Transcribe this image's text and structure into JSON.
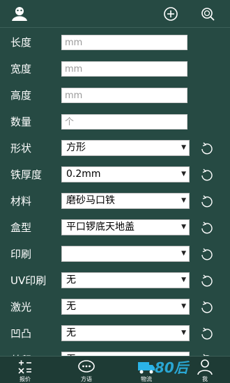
{
  "header": {
    "add_icon": "plus-circle-icon",
    "search_icon": "search-icon",
    "logo_icon": "app-logo-icon"
  },
  "fields": [
    {
      "label": "长度",
      "placeholder": "mm",
      "value": ""
    },
    {
      "label": "宽度",
      "placeholder": "mm",
      "value": ""
    },
    {
      "label": "高度",
      "placeholder": "mm",
      "value": ""
    },
    {
      "label": "数量",
      "placeholder": "个",
      "value": ""
    }
  ],
  "selects": [
    {
      "label": "形状",
      "value": "方形"
    },
    {
      "label": "铁厚度",
      "value": "0.2mm"
    },
    {
      "label": "材料",
      "value": "磨砂马口铁"
    },
    {
      "label": "盒型",
      "value": "平口锣底天地盖"
    },
    {
      "label": "印刷",
      "value": ""
    },
    {
      "label": "UV印刷",
      "value": "无"
    },
    {
      "label": "激光",
      "value": "无"
    },
    {
      "label": "凹凸",
      "value": "无"
    },
    {
      "label": "丝印",
      "value": "无"
    }
  ],
  "bottom_nav": [
    {
      "label": "报价",
      "icon": "calculator-icon"
    },
    {
      "label": "方语",
      "icon": "chat-bubble-icon"
    },
    {
      "label": "物流",
      "icon": "truck-icon"
    },
    {
      "label": "我",
      "icon": "user-icon"
    }
  ],
  "watermark": "80后",
  "colors": {
    "background": "#264a43",
    "nav_background": "#1e3b35",
    "watermark": "#2bb3e6"
  }
}
